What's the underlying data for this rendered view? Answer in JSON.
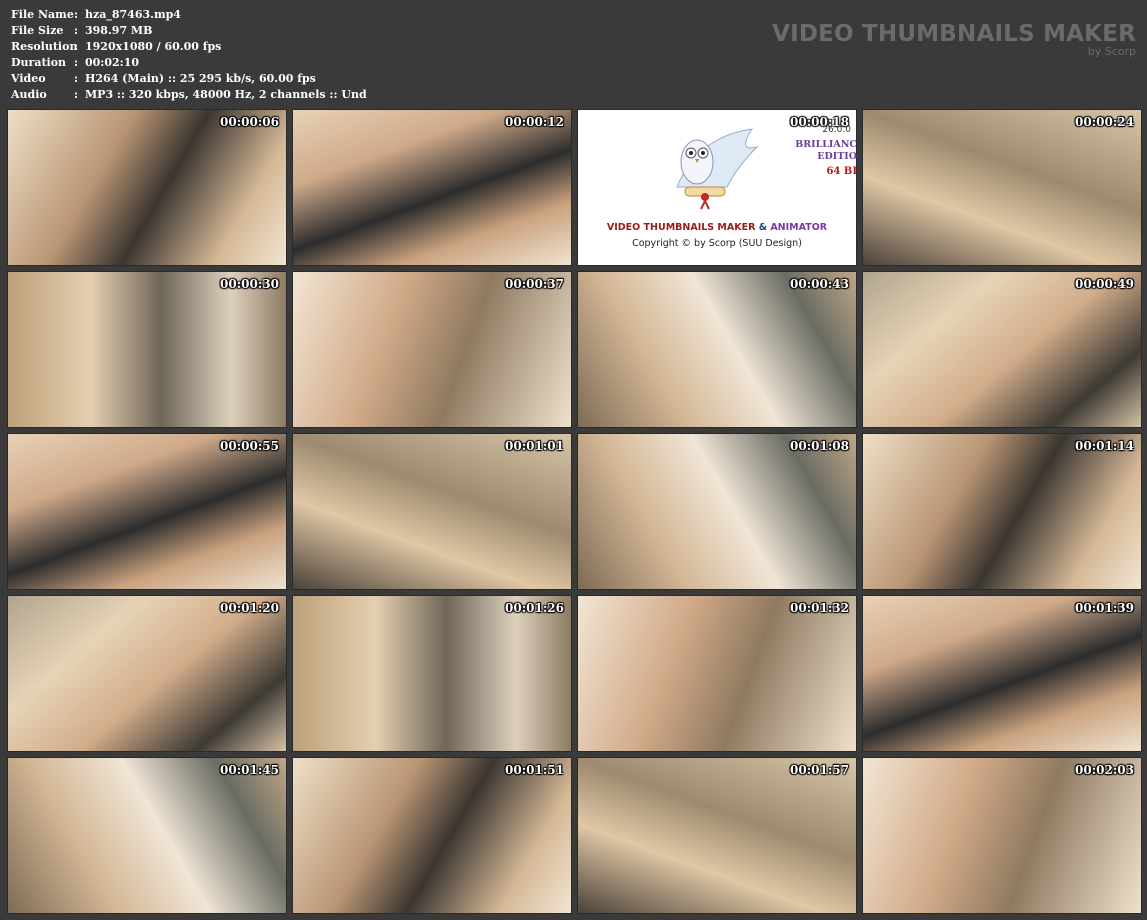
{
  "file_info": {
    "rows": [
      {
        "label": "File Name",
        "value": "hza_87463.mp4"
      },
      {
        "label": "File Size",
        "value": "398.97 MB"
      },
      {
        "label": "Resolution",
        "value": "1920x1080 / 60.00 fps"
      },
      {
        "label": "Duration",
        "value": "00:02:10"
      },
      {
        "label": "Video",
        "value": "H264 (Main) :: 25 295 kb/s, 60.00 fps"
      },
      {
        "label": "Audio",
        "value": "MP3 :: 320 kbps, 48000 Hz, 2 channels :: Und"
      }
    ],
    "separator": ":"
  },
  "brand": {
    "title": "VIDEO THUMBNAILS MAKER",
    "subtitle": "by Scorp"
  },
  "logo": {
    "title_part1": "VIDEO THUMBNAILS MAKER",
    "title_part2": " & ",
    "title_part3": "ANIMATOR",
    "copyright": "Copyright © by Scorp (SUU Design)",
    "version": "26.0.0",
    "edition_line1": "BRILLIANC",
    "edition_line2": "EDITIO",
    "bits": "64 BI"
  },
  "thumbnails": [
    {
      "time": "00:00:06"
    },
    {
      "time": "00:00:12"
    },
    {
      "time": "00:00:18"
    },
    {
      "time": "00:00:24"
    },
    {
      "time": "00:00:30"
    },
    {
      "time": "00:00:37"
    },
    {
      "time": "00:00:43"
    },
    {
      "time": "00:00:49"
    },
    {
      "time": "00:00:55"
    },
    {
      "time": "00:01:01"
    },
    {
      "time": "00:01:08"
    },
    {
      "time": "00:01:14"
    },
    {
      "time": "00:01:20"
    },
    {
      "time": "00:01:26"
    },
    {
      "time": "00:01:32"
    },
    {
      "time": "00:01:39"
    },
    {
      "time": "00:01:45"
    },
    {
      "time": "00:01:51"
    },
    {
      "time": "00:01:57"
    },
    {
      "time": "00:02:03"
    }
  ],
  "colors": {
    "background": "#3a3a3a",
    "brand_text": "#6b6b6b",
    "timestamp_text": "#ffffff"
  }
}
